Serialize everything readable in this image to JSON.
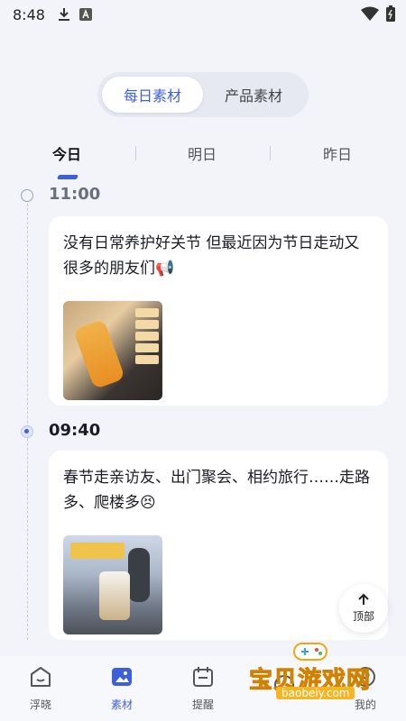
{
  "status_bar": {
    "time": "8:48"
  },
  "segment": {
    "items": [
      {
        "label": "每日素材"
      },
      {
        "label": "产品素材"
      }
    ]
  },
  "day_tabs": [
    {
      "label": "今日"
    },
    {
      "label": "明日"
    },
    {
      "label": "昨日"
    }
  ],
  "timeline": [
    {
      "time": "11:00",
      "text": "没有日常养护好关节 但最近因为节日走动又很多的朋友们📢"
    },
    {
      "time": "09:40",
      "text": "春节走亲访友、出门聚会、相约旅行……走路多、爬楼多😣"
    }
  ],
  "back_to_top": {
    "label": "顶部"
  },
  "bottom_nav": [
    {
      "label": "浮晓"
    },
    {
      "label": "素材"
    },
    {
      "label": "提醒"
    },
    {
      "label": ""
    },
    {
      "label": "我的"
    }
  ],
  "watermark": {
    "title": "宝贝游戏网",
    "url": "baobeiy.com"
  },
  "colors": {
    "accent": "#3d5fd9",
    "background": "#f2f4fa",
    "card": "#ffffff"
  }
}
